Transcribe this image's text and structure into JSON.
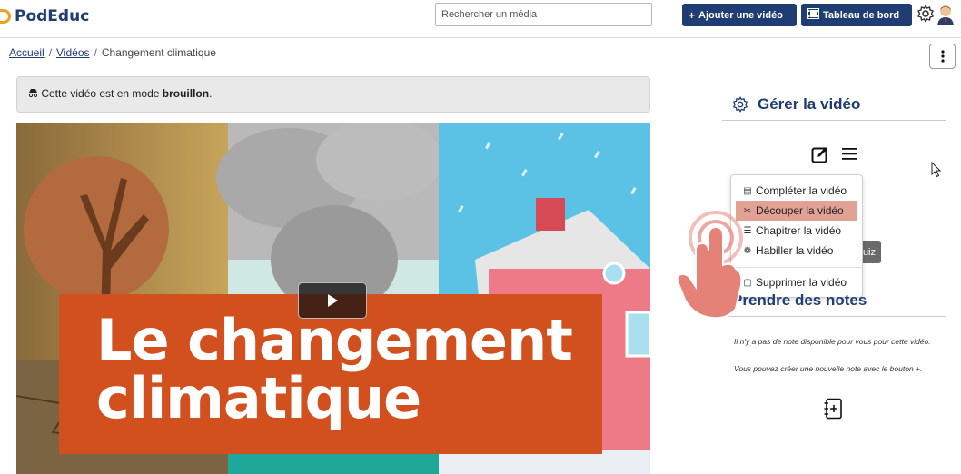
{
  "header": {
    "logo_text": "PodEduc",
    "search_placeholder": "Rechercher un média",
    "add_video_label": "Ajouter une vidéo",
    "dashboard_label": "Tableau de bord",
    "icons": [
      "plus-icon",
      "film-icon",
      "gear-icon",
      "avatar"
    ]
  },
  "breadcrumb": {
    "home": "Accueil",
    "videos": "Vidéos",
    "current": "Changement climatique"
  },
  "draft_notice": {
    "prefix": "Cette vidéo est en mode",
    "mode": "brouillon",
    "suffix": "."
  },
  "video": {
    "title_line1": "Le changement",
    "title_line2": "climatique"
  },
  "sidebar": {
    "manage_title": "Gérer la vidéo",
    "dropdown_items": [
      {
        "label": "Compléter la vidéo",
        "icon": "document-icon"
      },
      {
        "label": "Découper la vidéo",
        "icon": "scissors-icon",
        "active": true
      },
      {
        "label": "Chapitrer la vidéo",
        "icon": "list-icon"
      },
      {
        "label": "Habiller la vidéo",
        "icon": "palette-icon"
      },
      {
        "label": "Supprimer la vidéo",
        "icon": "trash-icon"
      }
    ],
    "quiz_label": "uiz",
    "notes_title": "Prendre des notes",
    "notes_empty": "Il n'y a pas de note disponible pour vous pour cette vidéo.",
    "notes_hint": "Vous pouvez créer une nouvelle note avec le bouton +."
  },
  "colors": {
    "brand": "#1f3c73",
    "title_band": "#d2501e",
    "active_item": "#e2a195"
  }
}
